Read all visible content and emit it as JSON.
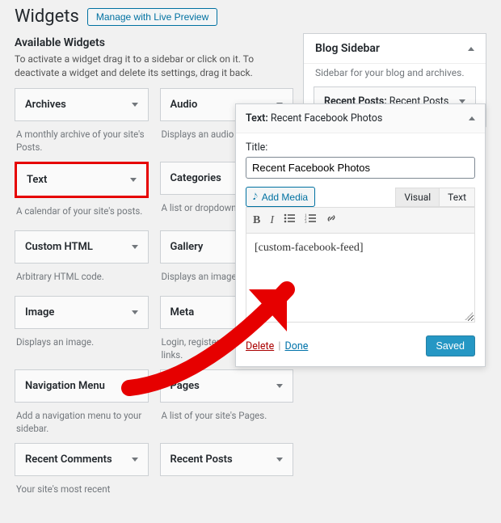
{
  "header": {
    "title": "Widgets",
    "live_preview_label": "Manage with Live Preview"
  },
  "available": {
    "title": "Available Widgets",
    "desc": "To activate a widget drag it to a sidebar or click on it. To deactivate a widget and delete its settings, drag it back.",
    "items": [
      {
        "name": "Archives",
        "desc": "A monthly archive of your site's Posts."
      },
      {
        "name": "Audio",
        "desc": "Displays an audio player."
      },
      {
        "name": "Text",
        "desc": "A calendar of your site's posts."
      },
      {
        "name": "Categories",
        "desc": "A list or dropdown of cat"
      },
      {
        "name": "Custom HTML",
        "desc": "Arbitrary HTML code."
      },
      {
        "name": "Gallery",
        "desc": "Displays an image gallery"
      },
      {
        "name": "Image",
        "desc": "Displays an image."
      },
      {
        "name": "Meta",
        "desc": "Login, register, WordPress links."
      },
      {
        "name": "Navigation Menu",
        "desc": "Add a navigation menu to your sidebar."
      },
      {
        "name": "Pages",
        "desc": "A list of your site's Pages."
      },
      {
        "name": "Recent Comments",
        "desc": "Your site's most recent"
      },
      {
        "name": "Recent Posts",
        "desc": ""
      }
    ]
  },
  "sidebar": {
    "title": "Blog Sidebar",
    "desc": "Sidebar for your blog and archives.",
    "widget_type": "Recent Posts:",
    "widget_value": "Recent Posts"
  },
  "editor": {
    "heading_type": "Text:",
    "heading_value": "Recent Facebook Photos",
    "title_label": "Title:",
    "title_value": "Recent Facebook Photos",
    "add_media_label": "Add Media",
    "tab_visual": "Visual",
    "tab_text": "Text",
    "content": "[custom-facebook-feed]",
    "delete_label": "Delete",
    "done_label": "Done",
    "saved_label": "Saved"
  }
}
